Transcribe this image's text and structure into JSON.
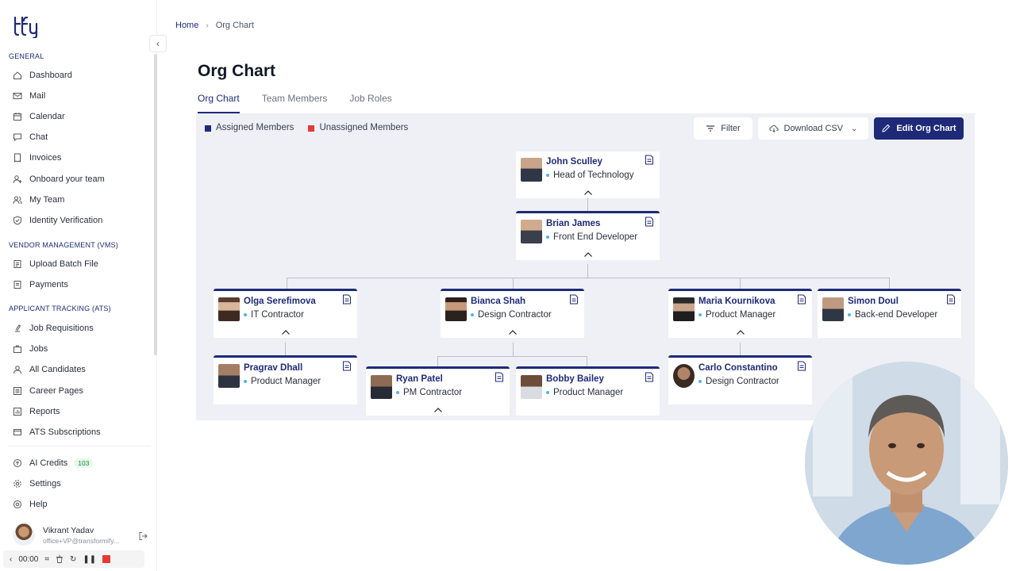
{
  "sidebar": {
    "sections": [
      {
        "title": "GENERAL"
      },
      {
        "title": "VENDOR MANAGEMENT (VMS)"
      },
      {
        "title": "APPLICANT TRACKING (ATS)"
      }
    ],
    "items": [
      {
        "label": "Dashboard",
        "icon": "home-icon"
      },
      {
        "label": "Mail",
        "icon": "mail-icon"
      },
      {
        "label": "Calendar",
        "icon": "calendar-icon"
      },
      {
        "label": "Chat",
        "icon": "chat-icon"
      },
      {
        "label": "Invoices",
        "icon": "invoice-icon"
      },
      {
        "label": "Onboard your team",
        "icon": "onboard-icon"
      },
      {
        "label": "My Team",
        "icon": "team-icon"
      },
      {
        "label": "Identity Verification",
        "icon": "shield-icon"
      },
      {
        "label": "Upload Batch File",
        "icon": "upload-icon"
      },
      {
        "label": "Payments",
        "icon": "payments-icon"
      },
      {
        "label": "Job Requisitions",
        "icon": "requisition-icon"
      },
      {
        "label": "Jobs",
        "icon": "briefcase-icon"
      },
      {
        "label": "All Candidates",
        "icon": "user-icon"
      },
      {
        "label": "Career Pages",
        "icon": "pages-icon"
      },
      {
        "label": "Reports",
        "icon": "reports-icon"
      },
      {
        "label": "ATS Subscriptions",
        "icon": "subscription-icon"
      },
      {
        "label": "AI Credits",
        "icon": "credits-icon",
        "badge": "103"
      },
      {
        "label": "Settings",
        "icon": "gear-icon"
      },
      {
        "label": "Help",
        "icon": "help-icon"
      }
    ],
    "user": {
      "name": "Vikrant Yadav",
      "email": "office+VP@transformify..."
    }
  },
  "recorder": {
    "time": "00:00"
  },
  "breadcrumb": {
    "home": "Home",
    "current": "Org Chart"
  },
  "page": {
    "title": "Org Chart"
  },
  "tabs": [
    {
      "label": "Org Chart",
      "active": true
    },
    {
      "label": "Team Members",
      "active": false
    },
    {
      "label": "Job Roles",
      "active": false
    }
  ],
  "legend": {
    "assigned": {
      "label": "Assigned Members",
      "color": "#1e2a78"
    },
    "unassigned": {
      "label": "Unassigned Members",
      "color": "#e53935"
    }
  },
  "toolbar": {
    "filter": "Filter",
    "download": "Download CSV",
    "edit": "Edit Org Chart"
  },
  "org": {
    "john": {
      "name": "John Sculley",
      "role": "Head of Technology"
    },
    "brian": {
      "name": "Brian James",
      "role": "Front End Developer"
    },
    "olga": {
      "name": "Olga Serefimova",
      "role": "IT Contractor"
    },
    "bianca": {
      "name": "Bianca Shah",
      "role": "Design Contractor"
    },
    "maria": {
      "name": "Maria Kournikova",
      "role": "Product Manager"
    },
    "simon": {
      "name": "Simon Doul",
      "role": "Back-end Developer"
    },
    "pragrav": {
      "name": "Pragrav Dhall",
      "role": "Product Manager"
    },
    "ryan": {
      "name": "Ryan Patel",
      "role": "PM Contractor"
    },
    "bobby": {
      "name": "Bobby Bailey",
      "role": "Product Manager"
    },
    "carlo": {
      "name": "Carlo Constantino",
      "role": "Design Contractor"
    }
  }
}
